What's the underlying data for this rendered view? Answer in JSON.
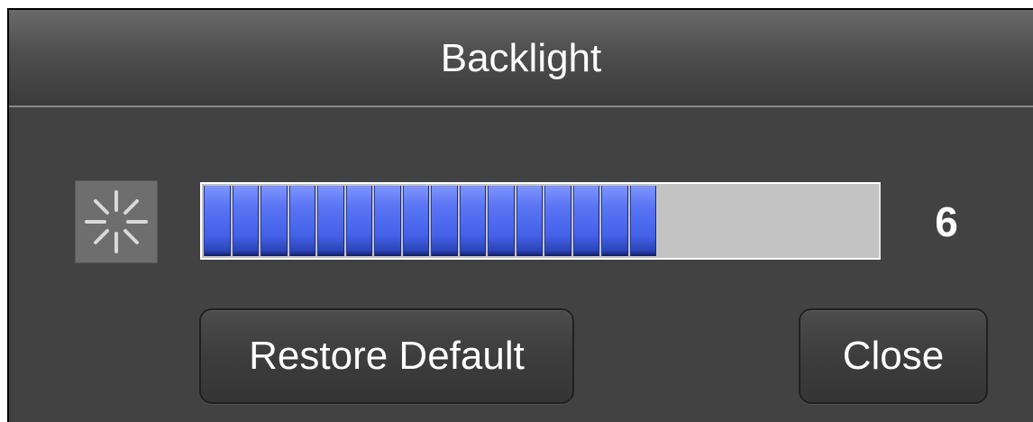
{
  "dialog": {
    "title": "Backlight"
  },
  "backlight": {
    "icon": "brightness-sun-icon",
    "level_value": "6",
    "level_fill_fraction": 0.667,
    "segments_filled": 16
  },
  "buttons": {
    "restore_default_label": "Restore Default",
    "close_label": "Close"
  },
  "colors": {
    "dialog_background": "#424242",
    "slider_fill": "#4462ea",
    "slider_track": "#c3c3c3",
    "text": "#ffffff"
  }
}
